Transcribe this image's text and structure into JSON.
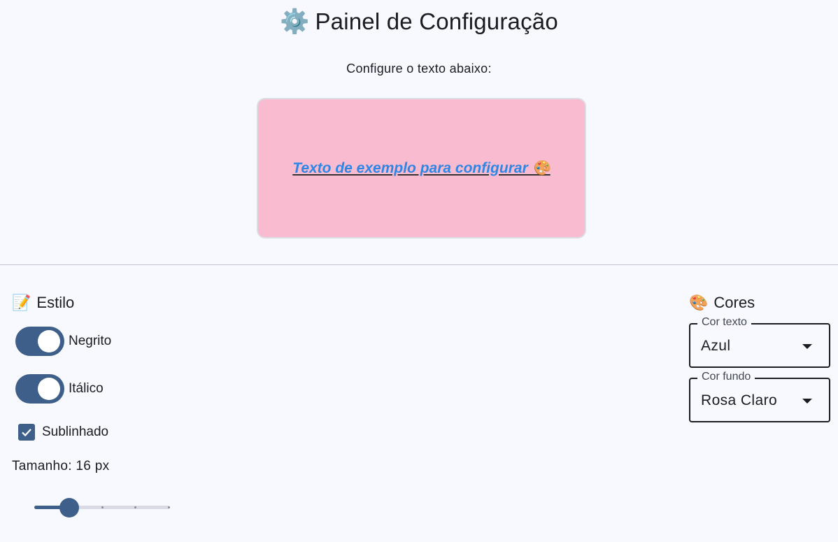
{
  "header": {
    "icon": "gear-icon",
    "title": "Painel de Configuração",
    "subtitle": "Configure o texto abaixo:"
  },
  "preview": {
    "text": "Texto de exemplo para configurar 🎨",
    "text_color": "#2f86e5",
    "background_color": "#f8bbd0"
  },
  "style_section": {
    "icon": "memo-icon",
    "title": "Estilo",
    "bold": {
      "label": "Negrito",
      "on": true
    },
    "italic": {
      "label": "Itálico",
      "on": true
    },
    "underline": {
      "label": "Sublinhado",
      "checked": true
    },
    "size_label": "Tamanho: 16 px",
    "size_slider": {
      "min": 12,
      "max": 32,
      "value": 16
    }
  },
  "colors_section": {
    "icon": "palette-icon",
    "title": "Cores",
    "text_color_field": {
      "label": "Cor texto",
      "value": "Azul"
    },
    "bg_color_field": {
      "label": "Cor fundo",
      "value": "Rosa Claro"
    }
  },
  "accent_color": "#3e5f8a"
}
